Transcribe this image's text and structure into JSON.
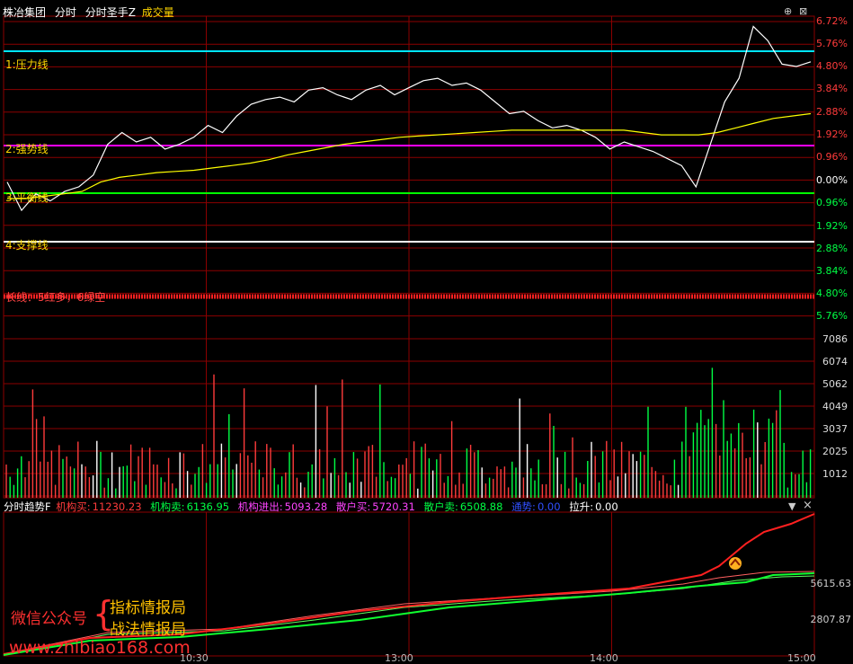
{
  "header": {
    "stock_name": "株冶集团",
    "tab_intraday": "分时",
    "indicator": "分时圣手Z",
    "volume": "成交量",
    "btn_up": "⊕",
    "btn_close": "⊠"
  },
  "price_axis": [
    "6.72%",
    "5.76%",
    "4.80%",
    "3.84%",
    "2.88%",
    "1.92%",
    "0.96%",
    "0.00%",
    "0.96%",
    "1.92%",
    "2.88%",
    "3.84%",
    "4.80%",
    "5.76%"
  ],
  "line_labels": {
    "pressure": "1:压力线",
    "strong": "2:强势线",
    "balance": "3:平衡线",
    "support": "4:支撑线",
    "long_line": "长线：5红多，6绿空"
  },
  "volume_axis": [
    "7086",
    "6074",
    "5062",
    "4049",
    "3037",
    "2025",
    "1012"
  ],
  "indicator_bar": {
    "name": "分时趋势F",
    "inst_buy_label": "机构买:",
    "inst_buy": "11230.23",
    "inst_sell_label": "机构卖:",
    "inst_sell": "6136.95",
    "inst_net_label": "机构进出:",
    "inst_net": "5093.28",
    "retail_buy_label": "散户买:",
    "retail_buy": "5720.31",
    "retail_sell_label": "散户卖:",
    "retail_sell": "6508.88",
    "signal_label": "通势:",
    "signal": "0.00",
    "rise_label": "拉升:",
    "rise": "0.00",
    "btn_menu": "▼",
    "btn_close": "×"
  },
  "indicator_axis": [
    "5615.63",
    "2807.87"
  ],
  "time_axis": [
    "10:30",
    "13:00",
    "14:00",
    "15:00"
  ],
  "watermark": {
    "wechat": "微信公众号",
    "brace": "{",
    "line1": "指标情报局",
    "line2": "战法情报局",
    "site": "www.zhibiao168.com"
  },
  "colors": {
    "up": "#ff3b3b",
    "down": "#00ff44",
    "grid": "#8b0000",
    "pressure": "#00e5ff",
    "strong": "#ff00ff",
    "balance": "#00ff00",
    "support": "#ffffff",
    "avg": "#ffff00"
  },
  "chart_data": {
    "type": "line",
    "series": [
      {
        "name": "price_pct",
        "values": [
          -0.1,
          -1.3,
          -0.6,
          -0.9,
          -0.5,
          -0.3,
          0.2,
          1.5,
          2.0,
          1.6,
          1.8,
          1.3,
          1.5,
          1.8,
          2.3,
          2.0,
          2.7,
          3.2,
          3.4,
          3.5,
          3.3,
          3.8,
          3.9,
          3.6,
          3.4,
          3.8,
          4.0,
          3.6,
          3.9,
          4.2,
          4.3,
          4.0,
          4.1,
          3.8,
          3.3,
          2.8,
          2.9,
          2.5,
          2.2,
          2.3,
          2.1,
          1.8,
          1.3,
          1.6,
          1.4,
          1.2,
          0.9,
          0.6,
          -0.3,
          1.5,
          3.3,
          4.3,
          6.5,
          5.9,
          4.9,
          4.8,
          5.0
        ]
      },
      {
        "name": "avg_pct",
        "values": [
          -0.8,
          -0.8,
          -0.7,
          -0.6,
          -0.5,
          -0.1,
          0.1,
          0.2,
          0.3,
          0.35,
          0.4,
          0.5,
          0.6,
          0.7,
          0.85,
          1.05,
          1.2,
          1.35,
          1.5,
          1.6,
          1.7,
          1.8,
          1.85,
          1.9,
          1.95,
          2.0,
          2.05,
          2.1,
          2.1,
          2.1,
          2.1,
          2.1,
          2.1,
          2.1,
          2.0,
          1.9,
          1.9,
          1.9,
          2.0,
          2.2,
          2.4,
          2.6,
          2.7,
          2.8
        ]
      }
    ]
  }
}
